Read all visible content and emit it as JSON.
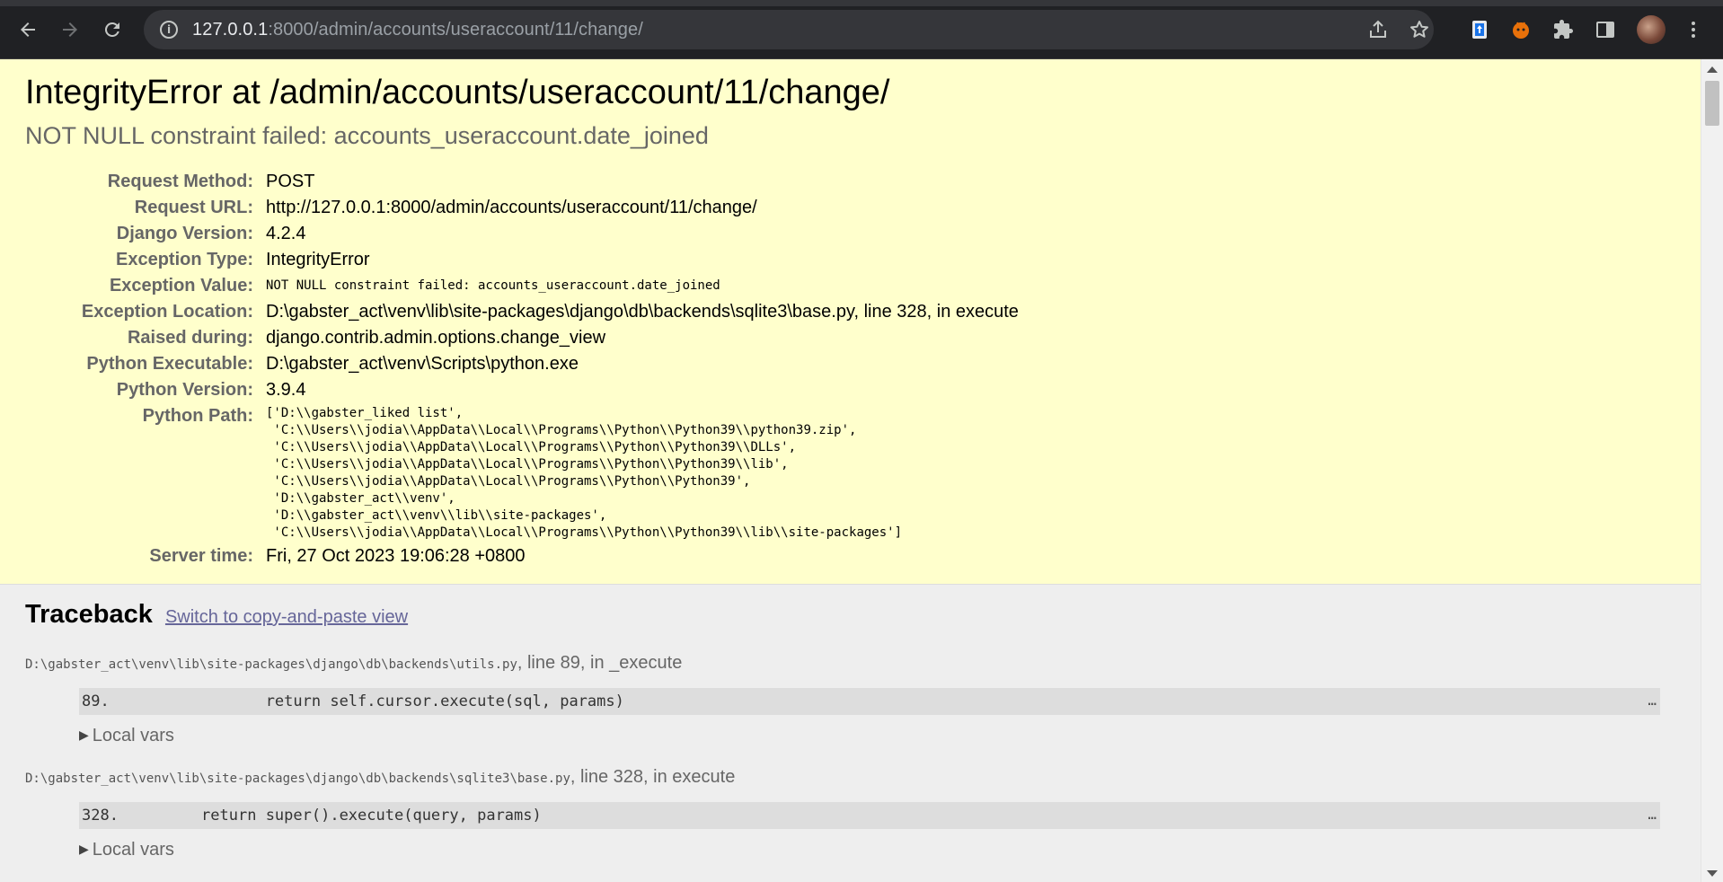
{
  "browser": {
    "url_host": "127.0.0.1",
    "url_rest": ":8000/admin/accounts/useraccount/11/change/",
    "icons": {
      "back": "back-arrow-icon",
      "forward": "forward-arrow-icon",
      "reload": "reload-icon",
      "site_info": "info-icon",
      "share": "share-icon",
      "bookmark": "star-icon",
      "extension_1": "extension-icon",
      "extension_2": "extension-icon",
      "extensions": "puzzle-icon",
      "side_panel": "side-panel-icon",
      "menu": "kebab-menu-icon"
    }
  },
  "error": {
    "title": "IntegrityError at /admin/accounts/useraccount/11/change/",
    "subtitle": "NOT NULL constraint failed: accounts_useraccount.date_joined",
    "meta": [
      {
        "label": "Request Method:",
        "value": "POST"
      },
      {
        "label": "Request URL:",
        "value": "http://127.0.0.1:8000/admin/accounts/useraccount/11/change/"
      },
      {
        "label": "Django Version:",
        "value": "4.2.4"
      },
      {
        "label": "Exception Type:",
        "value": "IntegrityError"
      },
      {
        "label": "Exception Value:",
        "value": "NOT NULL constraint failed: accounts_useraccount.date_joined"
      },
      {
        "label": "Exception Location:",
        "value": "D:\\gabster_act\\venv\\lib\\site-packages\\django\\db\\backends\\sqlite3\\base.py, line 328, in execute"
      },
      {
        "label": "Raised during:",
        "value": "django.contrib.admin.options.change_view"
      },
      {
        "label": "Python Executable:",
        "value": "D:\\gabster_act\\venv\\Scripts\\python.exe"
      },
      {
        "label": "Python Version:",
        "value": "3.9.4"
      },
      {
        "label": "Python Path:",
        "value": "['D:\\\\gabster_liked list',\n 'C:\\\\Users\\\\jodia\\\\AppData\\\\Local\\\\Programs\\\\Python\\\\Python39\\\\python39.zip',\n 'C:\\\\Users\\\\jodia\\\\AppData\\\\Local\\\\Programs\\\\Python\\\\Python39\\\\DLLs',\n 'C:\\\\Users\\\\jodia\\\\AppData\\\\Local\\\\Programs\\\\Python\\\\Python39\\\\lib',\n 'C:\\\\Users\\\\jodia\\\\AppData\\\\Local\\\\Programs\\\\Python\\\\Python39',\n 'D:\\\\gabster_act\\\\venv',\n 'D:\\\\gabster_act\\\\venv\\\\lib\\\\site-packages',\n 'C:\\\\Users\\\\jodia\\\\AppData\\\\Local\\\\Programs\\\\Python\\\\Python39\\\\lib\\\\site-packages']"
      },
      {
        "label": "Server time:",
        "value": "Fri, 27 Oct 2023 19:06:28 +0800"
      }
    ]
  },
  "traceback": {
    "heading": "Traceback",
    "switch_link": "Switch to copy-and-paste view",
    "frames": [
      {
        "file": "D:\\gabster_act\\venv\\lib\\site-packages\\django\\db\\backends\\utils.py",
        "where": ", line 89, in _execute",
        "code": "89.                 return self.cursor.execute(sql, params)",
        "more": "…",
        "vars_label": "Local vars"
      },
      {
        "file": "D:\\gabster_act\\venv\\lib\\site-packages\\django\\db\\backends\\sqlite3\\base.py",
        "where": ", line 328, in execute",
        "code": "328.         return super().execute(query, params)",
        "more": "…",
        "vars_label": "Local vars"
      }
    ]
  },
  "colors": {
    "summary_bg": "#ffffcc",
    "page_bg": "#eeeeee",
    "chrome_bg": "#202124",
    "omnibox_bg": "#35363a",
    "link": "#666699"
  }
}
